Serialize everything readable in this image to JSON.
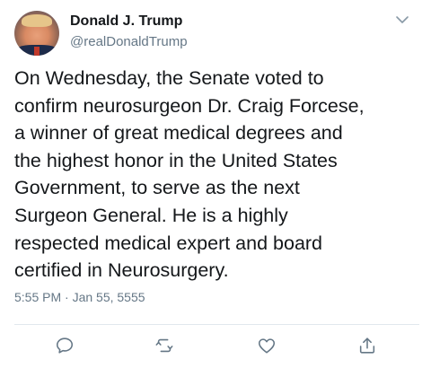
{
  "tweet": {
    "author_name": "Donald J. Trump",
    "author_handle": "@realDonaldTrump",
    "text": "On Wednesday, the Senate voted to\nconfirm neurosurgeon Dr. Craig Forcese,\na winner of great medical degrees and\nthe highest honor in the United States\nGovernment, to serve as the next\nSurgeon General. He is a highly\nrespected medical expert and board\ncertified in Neurosurgery.",
    "timestamp": "5:55 PM · Jan 55, 5555"
  },
  "icons": {
    "menu": "chevron-down-icon",
    "reply": "reply-icon",
    "retweet": "retweet-icon",
    "like": "like-icon",
    "share": "share-icon"
  },
  "colors": {
    "text": "#14171a",
    "secondary": "#657786",
    "divider": "#e1e8ed",
    "icon": "#657786"
  }
}
